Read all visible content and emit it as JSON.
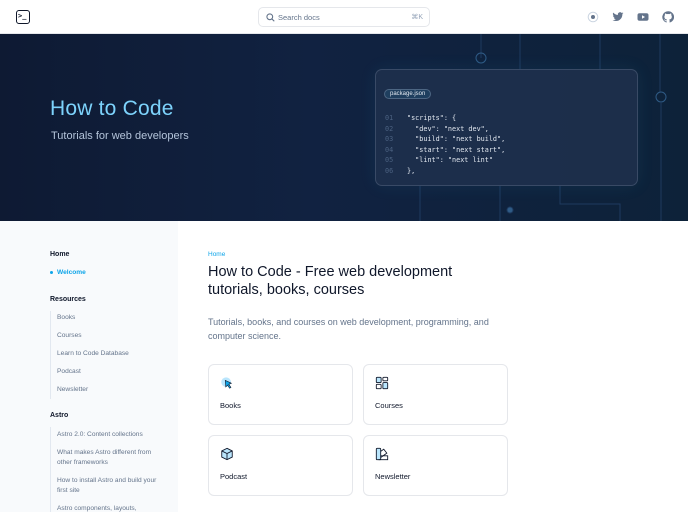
{
  "header": {
    "logo_icon": "terminal-icon",
    "search_placeholder": "Search docs",
    "search_shortcut": "⌘K",
    "icons": [
      "theme-toggle-icon",
      "twitter-icon",
      "youtube-icon",
      "github-icon"
    ]
  },
  "hero": {
    "title": "How to Code",
    "subtitle": "Tutorials for web developers",
    "code_tab": "package.json",
    "code": [
      {
        "n": "01",
        "text": "\"scripts\": {"
      },
      {
        "n": "02",
        "text": "  \"dev\": \"next dev\","
      },
      {
        "n": "03",
        "text": "  \"build\": \"next build\","
      },
      {
        "n": "04",
        "text": "  \"start\": \"next start\","
      },
      {
        "n": "05",
        "text": "  \"lint\": \"next lint\""
      },
      {
        "n": "06",
        "text": "},"
      }
    ]
  },
  "sidebar": {
    "home_heading": "Home",
    "home_items": [
      "Welcome"
    ],
    "resources_heading": "Resources",
    "resources_items": [
      "Books",
      "Courses",
      "Learn to Code Database",
      "Podcast",
      "Newsletter"
    ],
    "astro_heading": "Astro",
    "astro_items": [
      "Astro 2.0: Content collections",
      "What makes Astro different from other frameworks",
      "How to install Astro and build your first site",
      "Astro components, layouts,"
    ]
  },
  "main": {
    "breadcrumb": "Home",
    "title": "How to Code - Free web development tutorials, books, courses",
    "description": "Tutorials, books, and courses on web development, programming, and computer science.",
    "cards": [
      {
        "label": "Books",
        "icon": "cursor-pointer-icon"
      },
      {
        "label": "Courses",
        "icon": "layout-grid-icon"
      },
      {
        "label": "Podcast",
        "icon": "cube-icon"
      },
      {
        "label": "Newsletter",
        "icon": "color-swatch-icon"
      }
    ]
  },
  "colors": {
    "accent": "#0ea5e9",
    "hero_bg": "#0e1a33",
    "hero_title": "#7dd3fc"
  }
}
